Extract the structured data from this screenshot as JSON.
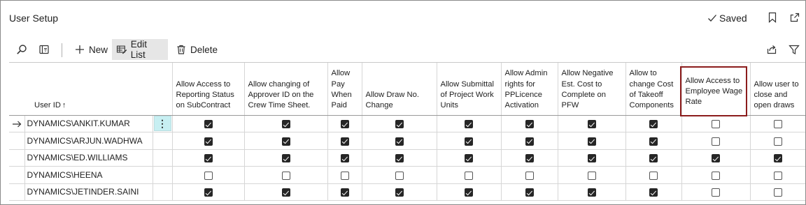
{
  "page": {
    "title": "User Setup",
    "saved_label": "Saved"
  },
  "header_icons": [
    "bookmark-icon",
    "open-in-new-window-icon"
  ],
  "actions": {
    "new_label": "New",
    "edit_list_label": "Edit List",
    "delete_label": "Delete"
  },
  "columns": {
    "user_id": "User ID",
    "sort_indicator": "↑",
    "allow_access_reporting": "Allow Access to Reporting Status on SubContract",
    "allow_change_approver": "Allow changing of Approver ID on the Crew Time Sheet.",
    "allow_pay_when_paid": "Allow Pay When Paid",
    "allow_draw_no_change": "Allow Draw No. Change",
    "allow_submittal": "Allow Submittal of Project Work Units",
    "allow_admin_rights": "Allow Admin rights for PPLicence Activation",
    "allow_negative_est": "Allow Negative Est. Cost to Complete on PFW",
    "allow_change_cost": "Allow to change Cost of Takeoff Components",
    "allow_access_wage": "Allow Access to Employee Wage Rate",
    "allow_close_open_draws": "Allow user to close and open draws"
  },
  "rows": [
    {
      "user_id": "DYNAMICS\\ANKIT.KUMAR",
      "current": true,
      "values": [
        true,
        true,
        true,
        true,
        true,
        true,
        true,
        true,
        false,
        false
      ]
    },
    {
      "user_id": "DYNAMICS\\ARJUN.WADHWA",
      "current": false,
      "values": [
        true,
        true,
        true,
        true,
        true,
        true,
        true,
        true,
        false,
        false
      ]
    },
    {
      "user_id": "DYNAMICS\\ED.WILLIAMS",
      "current": false,
      "values": [
        true,
        true,
        true,
        true,
        true,
        true,
        true,
        true,
        true,
        true
      ]
    },
    {
      "user_id": "DYNAMICS\\HEENA",
      "current": false,
      "values": [
        false,
        false,
        false,
        false,
        false,
        false,
        false,
        false,
        false,
        false
      ]
    },
    {
      "user_id": "DYNAMICS\\JETINDER.SAINI",
      "current": false,
      "values": [
        true,
        true,
        true,
        true,
        true,
        true,
        true,
        true,
        false,
        false
      ]
    }
  ],
  "colors": {
    "accent_highlight": "#8b1c1c",
    "menu_button_bg": "#c7eff2",
    "selected_action_bg": "#e6e6e6"
  }
}
